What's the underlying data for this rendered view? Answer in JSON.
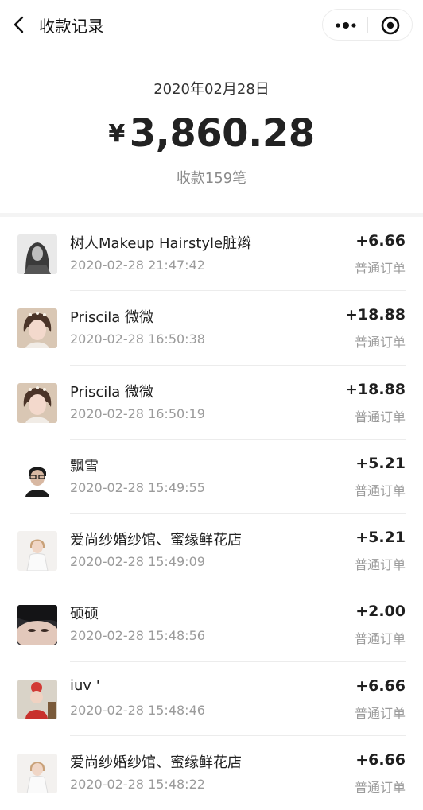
{
  "nav": {
    "title": "收款记录",
    "back_icon": "chevron-left-icon",
    "more_icon": "more-dots-icon",
    "close_icon": "target-close-icon"
  },
  "summary": {
    "date": "2020年02月28日",
    "currency_symbol": "¥",
    "amount": "3,860.28",
    "count_text": "收款159笔"
  },
  "records": [
    {
      "name": "树人Makeup Hairstyle脏辫",
      "time": "2020-02-28 21:47:42",
      "amount": "+6.66",
      "type": "普通订单",
      "avatar": "avatar-bw-portrait"
    },
    {
      "name": "Priscila 微微",
      "time": "2020-02-28 16:50:38",
      "amount": "+18.88",
      "type": "普通订单",
      "avatar": "avatar-bride-portrait"
    },
    {
      "name": "Priscila 微微",
      "time": "2020-02-28 16:50:19",
      "amount": "+18.88",
      "type": "普通订单",
      "avatar": "avatar-bride-portrait"
    },
    {
      "name": "飘雪",
      "time": "2020-02-28 15:49:55",
      "amount": "+5.21",
      "type": "普通订单",
      "avatar": "avatar-glasses-portrait"
    },
    {
      "name": "爱尚纱婚纱馆、蜜缘鲜花店",
      "time": "2020-02-28 15:49:09",
      "amount": "+5.21",
      "type": "普通订单",
      "avatar": "avatar-woman-white"
    },
    {
      "name": "硕硕",
      "time": "2020-02-28 15:48:56",
      "amount": "+2.00",
      "type": "普通订单",
      "avatar": "avatar-closeup-face"
    },
    {
      "name": "iuv '",
      "time": "2020-02-28 15:48:46",
      "amount": "+6.66",
      "type": "普通订单",
      "avatar": "avatar-child-red"
    },
    {
      "name": "爱尚纱婚纱馆、蜜缘鲜花店",
      "time": "2020-02-28 15:48:22",
      "amount": "+6.66",
      "type": "普通订单",
      "avatar": "avatar-woman-white"
    }
  ]
}
